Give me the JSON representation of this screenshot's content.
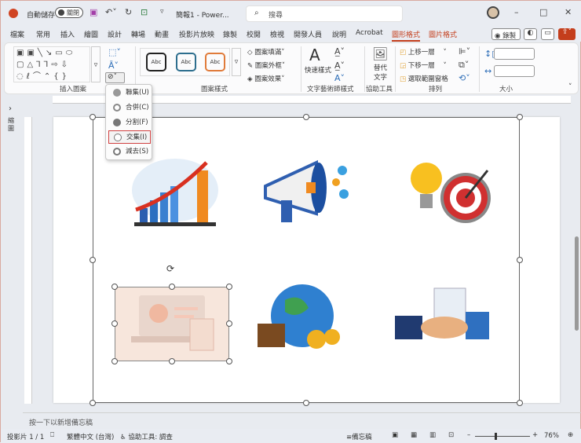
{
  "titlebar": {
    "autosave_label": "自動儲存",
    "autosave_state": "關閉",
    "doc_title": "簡報1 - Power...",
    "search_placeholder": "搜尋"
  },
  "tabs": [
    "檔案",
    "常用",
    "插入",
    "繪圖",
    "設計",
    "轉場",
    "動畫",
    "投影片放映",
    "錄製",
    "校閱",
    "檢視",
    "開發人員",
    "說明",
    "Acrobat",
    "圖形格式",
    "圖片格式"
  ],
  "active_tab": "圖形格式",
  "right_buttons": {
    "record": "錄製"
  },
  "ribbon": {
    "groups": {
      "insert_shapes": "插入圖案",
      "shape_styles": "圖案樣式",
      "wordart": "文字藝術師樣式",
      "accessibility": "協助工具",
      "arrange": "排列",
      "size": "大小"
    },
    "style_samples": [
      "Abc",
      "Abc",
      "Abc"
    ],
    "shape_fill": "圖案填滿",
    "shape_outline": "圖案外框",
    "shape_effects": "圖案效果",
    "quick_styles": "快速樣式",
    "alt_text": "替代\n文字",
    "alt_text_1": "替代",
    "alt_text_2": "文字",
    "bring_forward": "上移一層",
    "send_backward": "下移一層",
    "selection_pane": "選取範圍窗格",
    "height_value": "",
    "width_value": ""
  },
  "merge_menu": {
    "items": [
      {
        "label": "聯集(U)"
      },
      {
        "label": "合併(C)"
      },
      {
        "label": "分割(F)"
      },
      {
        "label": "交集(I)",
        "highlighted": true
      },
      {
        "label": "減去(S)"
      }
    ]
  },
  "sidebar": {
    "label": "縮圖"
  },
  "notes": {
    "placeholder": "按一下以新增備忘稿"
  },
  "status": {
    "slide": "投影片 1 / 1",
    "language": "繁體中文 (台灣)",
    "accessibility": "協助工具: 調查",
    "notes_btn": "備忘稿",
    "zoom": "76%",
    "zoom_percent": 76
  },
  "colors": {
    "accent": "#c43e1c",
    "highlight_border": "#d04040"
  }
}
